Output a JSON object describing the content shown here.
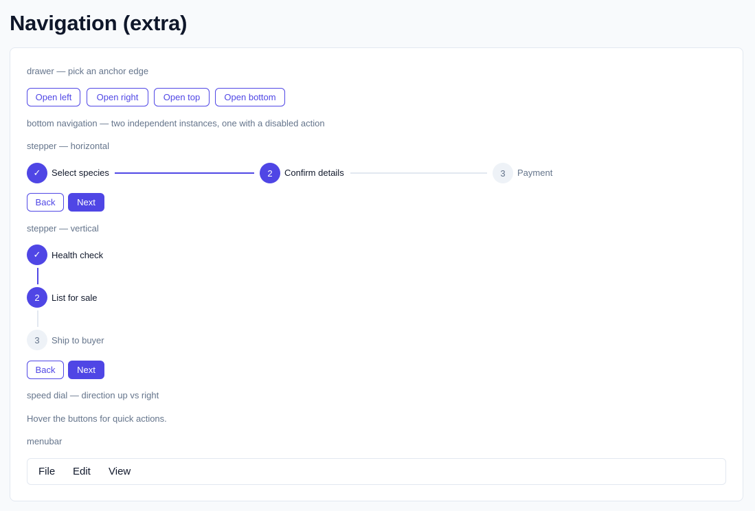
{
  "page": {
    "title": "Navigation (extra)"
  },
  "drawer": {
    "label": "drawer — pick an anchor edge",
    "buttons": [
      "Open left",
      "Open right",
      "Open top",
      "Open bottom"
    ]
  },
  "bottom_navigation": {
    "label": "bottom navigation — two independent instances, one with a disabled action"
  },
  "stepper_horizontal": {
    "label": "stepper — horizontal",
    "steps": [
      {
        "marker": "✓",
        "label": "Select species",
        "state": "completed"
      },
      {
        "marker": "2",
        "label": "Confirm details",
        "state": "active"
      },
      {
        "marker": "3",
        "label": "Payment",
        "state": "pending"
      }
    ],
    "back": "Back",
    "next": "Next"
  },
  "stepper_vertical": {
    "label": "stepper — vertical",
    "steps": [
      {
        "marker": "✓",
        "label": "Health check",
        "state": "completed"
      },
      {
        "marker": "2",
        "label": "List for sale",
        "state": "active"
      },
      {
        "marker": "3",
        "label": "Ship to buyer",
        "state": "pending"
      }
    ],
    "back": "Back",
    "next": "Next"
  },
  "speed_dial": {
    "label": "speed dial — direction up vs right",
    "hint": "Hover the buttons for quick actions."
  },
  "menubar": {
    "label": "menubar",
    "items": [
      "File",
      "Edit",
      "View"
    ]
  },
  "colors": {
    "accent": "#4f46e5",
    "background": "#f8fafc",
    "muted_text": "#64748b",
    "border": "#e2e8f0"
  }
}
